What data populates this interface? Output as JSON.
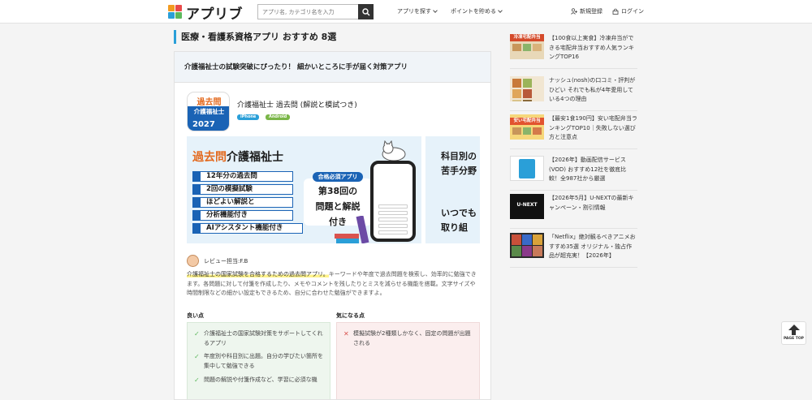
{
  "header": {
    "logo_text": "アプリブ",
    "search_placeholder": "アプリ名, カテゴリ名を入力",
    "nav": {
      "find_apps": "アプリを探す",
      "points": "ポイントを貯める",
      "register": "新規登録",
      "login": "ログイン"
    }
  },
  "main": {
    "page_title": "医療・看護系資格アプリ おすすめ 8選",
    "card": {
      "heading": "介護福祉士の試験突破にぴったり！ 細かいところに手が届く対策アプリ",
      "app_icon": {
        "line1": "過去問",
        "line2": "介護福祉士",
        "year": "2027"
      },
      "app_name": "介護福祉士 過去問 (解説と模試つき)",
      "badges": [
        "iPhone",
        "Android"
      ],
      "screenshot1": {
        "title_prefix": "過去問",
        "title_main": "介護福祉士",
        "features": [
          "12年分の過去問",
          "2回の模擬試験",
          "ほどよい解説と",
          "分析機能付き",
          "AIアシスタント機能付き"
        ],
        "must_label": "合格必須アプリ",
        "must_text": [
          "第38回の",
          "問題と解説",
          "付き"
        ]
      },
      "screenshot2": {
        "lines": [
          "科目別の",
          "苦手分野",
          "いつでも",
          "取り組"
        ]
      },
      "reviewer": "レビュー担当:F.B",
      "review_highlight": "介護福祉士の国家試験を合格するための過去問アプリ。",
      "review_rest": "キーワードや年度で過去問題を検索し、効率的に勉強できます。各問題に対して付箋を作成したり、メモやコメントを残したりとミスを減らせる機能を搭載。文字サイズや時間制限などの細かい設定もできるため、自分に合わせた勉強ができますよ。",
      "pros_title": "良い点",
      "cons_title": "気になる点",
      "pros": [
        "介護福祉士の国家試験対策をサポートしてくれるアプリ",
        "年度別や科目別に出題。自分の学びたい箇所を集中して勉強できる",
        "問題の解説や付箋作成など、学習に必須な機"
      ],
      "cons": [
        "模擬試験が2種類しかなく、固定の問題が出題される"
      ]
    }
  },
  "sidebar": {
    "items": [
      {
        "title": "【100食以上実食】冷凍弁当ができる宅配弁当おすすめ人気ランキングTOP16",
        "thumb_label": "冷凍宅配弁当"
      },
      {
        "title": "ナッシュ(nosh)の口コミ・評判がひどい それでも私が4年愛用している4つの理由",
        "thumb_label": ""
      },
      {
        "title": "【最安1食190円】安い宅配弁当ランキングTOP10｜失敗しない選び方と注意点",
        "thumb_label": "安い宅配弁当"
      },
      {
        "title": "【2026年】動画配信サービス(VOD) おすすめ12社を徹底比較！全987社から厳選",
        "thumb_label": ""
      },
      {
        "title": "【2026年5月】U-NEXTの最新キャンペーン・割引情報",
        "thumb_label": "U-NEXT"
      },
      {
        "title": "「Netflix」絶対観るべきアニメおすすめ35選 オリジナル・独占作品が超充実！【2026年】",
        "thumb_label": ""
      }
    ]
  },
  "page_top": "PAGE TOP",
  "colors": {
    "accent": "#2a9fd8",
    "brand_blue": "#1a63b5",
    "brand_orange": "#e36a1f"
  }
}
